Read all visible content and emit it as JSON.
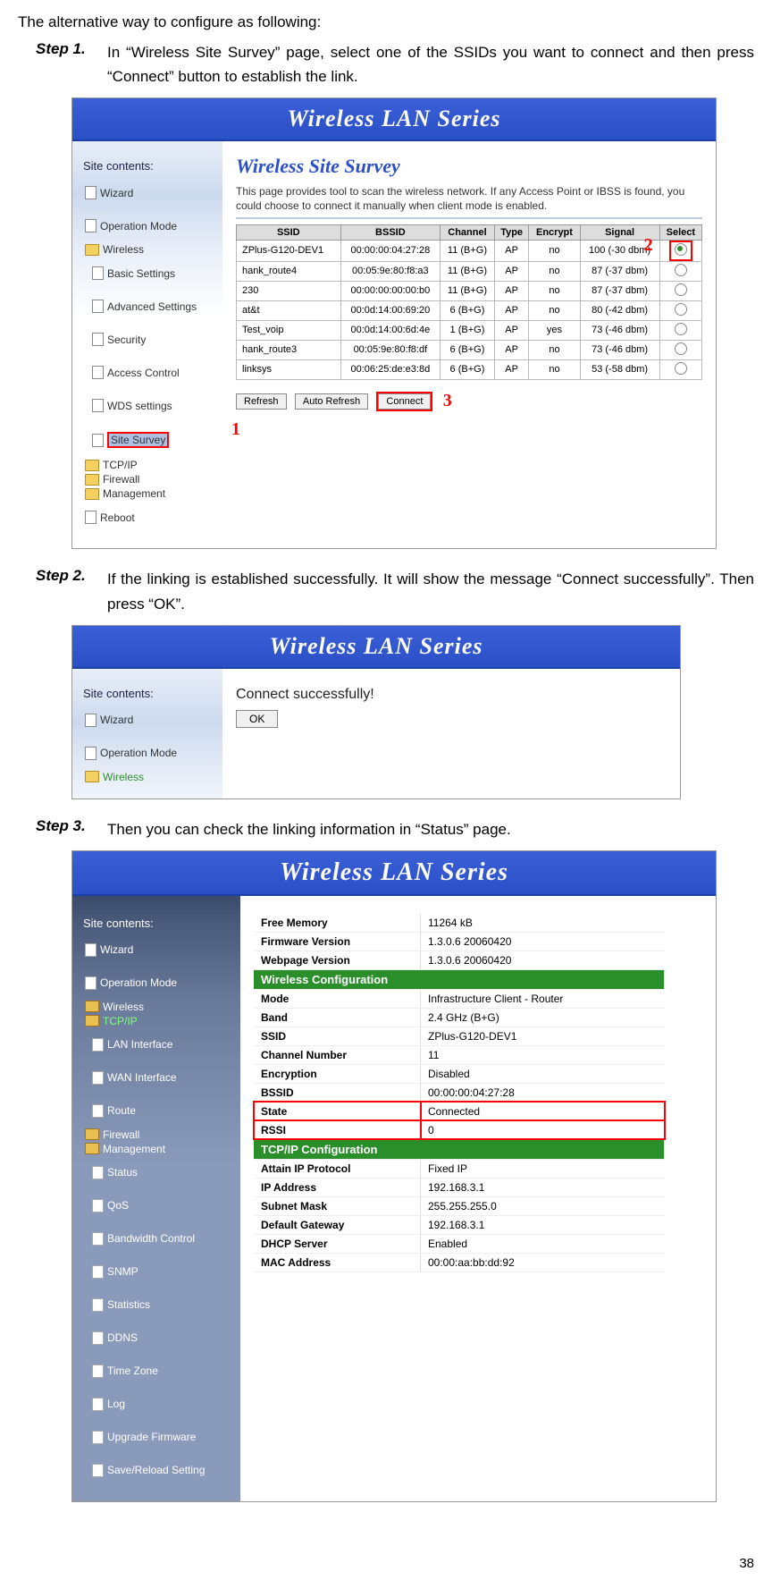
{
  "intro": "The alternative way to configure as following:",
  "step1": {
    "label": "Step 1.",
    "text": "In “Wireless Site Survey” page, select one of the SSIDs you want to connect and then press “Connect” button to establish the link."
  },
  "step2": {
    "label": "Step 2.",
    "text": "If the linking is established successfully. It will show the message “Connect successfully”. Then press “OK”."
  },
  "step3": {
    "label": "Step 3.",
    "text": "Then you can check the linking information in “Status” page."
  },
  "banner": "Wireless LAN Series",
  "side_title": "Site contents:",
  "nav1": {
    "wizard": "Wizard",
    "opmode": "Operation Mode",
    "wireless": "Wireless",
    "basic": "Basic Settings",
    "adv": "Advanced Settings",
    "sec": "Security",
    "ac": "Access Control",
    "wds": "WDS settings",
    "survey": "Site Survey",
    "tcp": "TCP/IP",
    "fw": "Firewall",
    "mgmt": "Management",
    "reboot": "Reboot"
  },
  "survey": {
    "title": "Wireless Site Survey",
    "desc": "This page provides tool to scan the wireless network. If any Access Point or IBSS is found, you could choose to connect it manually when client mode is enabled.",
    "cols": {
      "ssid": "SSID",
      "bssid": "BSSID",
      "channel": "Channel",
      "type": "Type",
      "encrypt": "Encrypt",
      "signal": "Signal",
      "select": "Select"
    },
    "rows": [
      {
        "ssid": "ZPlus-G120-DEV1",
        "bssid": "00:00:00:04:27:28",
        "ch": "11 (B+G)",
        "type": "AP",
        "enc": "no",
        "sig": "100 (-30 dbm)"
      },
      {
        "ssid": "hank_route4",
        "bssid": "00:05:9e:80:f8:a3",
        "ch": "11 (B+G)",
        "type": "AP",
        "enc": "no",
        "sig": "87 (-37 dbm)"
      },
      {
        "ssid": "230",
        "bssid": "00:00:00:00:00:b0",
        "ch": "11 (B+G)",
        "type": "AP",
        "enc": "no",
        "sig": "87 (-37 dbm)"
      },
      {
        "ssid": "at&t",
        "bssid": "00:0d:14:00:69:20",
        "ch": "6 (B+G)",
        "type": "AP",
        "enc": "no",
        "sig": "80 (-42 dbm)"
      },
      {
        "ssid": "Test_voip",
        "bssid": "00:0d:14:00:6d:4e",
        "ch": "1 (B+G)",
        "type": "AP",
        "enc": "yes",
        "sig": "73 (-46 dbm)"
      },
      {
        "ssid": "hank_route3",
        "bssid": "00:05:9e:80:f8:df",
        "ch": "6 (B+G)",
        "type": "AP",
        "enc": "no",
        "sig": "73 (-46 dbm)"
      },
      {
        "ssid": "linksys",
        "bssid": "00:06:25:de:e3:8d",
        "ch": "6 (B+G)",
        "type": "AP",
        "enc": "no",
        "sig": "53 (-58 dbm)"
      }
    ],
    "refresh": "Refresh",
    "auto": "Auto Refresh",
    "connect": "Connect"
  },
  "markers": {
    "one": "1",
    "two": "2",
    "three": "3"
  },
  "conn_msg": "Connect successfully!",
  "ok": "OK",
  "nav3": {
    "wizard": "Wizard",
    "opmode": "Operation Mode",
    "wireless": "Wireless",
    "tcp": "TCP/IP",
    "lan": "LAN Interface",
    "wan": "WAN Interface",
    "route": "Route",
    "fw": "Firewall",
    "mgmt": "Management",
    "status": "Status",
    "qos": "QoS",
    "bw": "Bandwidth Control",
    "snmp": "SNMP",
    "stats": "Statistics",
    "ddns": "DDNS",
    "tz": "Time Zone",
    "log": "Log",
    "upg": "Upgrade Firmware",
    "save": "Save/Reload Setting"
  },
  "status": {
    "freemem_l": "Free Memory",
    "freemem_v": "11264 kB",
    "fwv_l": "Firmware Version",
    "fwv_v": "1.3.0.6 20060420",
    "wpv_l": "Webpage Version",
    "wpv_v": "1.3.0.6 20060420",
    "wconf": "Wireless Configuration",
    "mode_l": "Mode",
    "mode_v": "Infrastructure Client - Router",
    "band_l": "Band",
    "band_v": "2.4 GHz (B+G)",
    "ssid_l": "SSID",
    "ssid_v": "ZPlus-G120-DEV1",
    "chn_l": "Channel Number",
    "chn_v": "11",
    "enc_l": "Encryption",
    "enc_v": "Disabled",
    "bssid_l": "BSSID",
    "bssid_v": "00:00:00:04:27:28",
    "state_l": "State",
    "state_v": "Connected",
    "rssi_l": "RSSI",
    "rssi_v": "0",
    "tcpip": "TCP/IP Configuration",
    "aip_l": "Attain IP Protocol",
    "aip_v": "Fixed IP",
    "ip_l": "IP Address",
    "ip_v": "192.168.3.1",
    "sm_l": "Subnet Mask",
    "sm_v": "255.255.255.0",
    "gw_l": "Default Gateway",
    "gw_v": "192.168.3.1",
    "dhcp_l": "DHCP Server",
    "dhcp_v": "Enabled",
    "mac_l": "MAC Address",
    "mac_v": "00:00:aa:bb:dd:92"
  },
  "pagenum": "38"
}
